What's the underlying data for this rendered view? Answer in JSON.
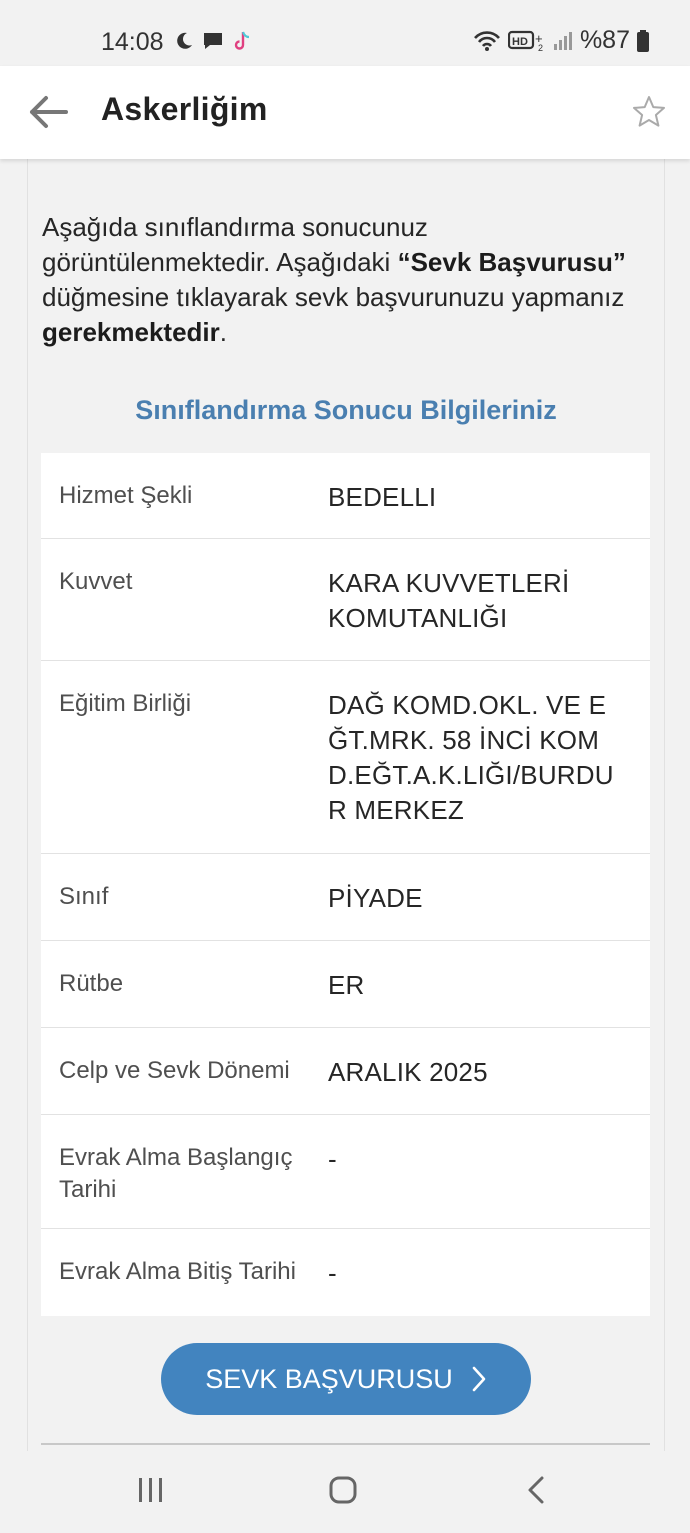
{
  "status_bar": {
    "time": "14:08",
    "battery": "%87",
    "icons_left": [
      "moon-icon",
      "message-icon",
      "tiktok-icon"
    ],
    "icons_right": [
      "wifi-icon",
      "hd-voice-icon",
      "signal-icon",
      "battery-icon"
    ]
  },
  "header": {
    "title": "Askerliğim"
  },
  "intro": {
    "part1": "Aşağıda sınıflandırma sonucunuz görüntülenmektedir. Aşağıdaki ",
    "bold1": "“Sevk Başvurusu”",
    "part2": " düğmesine tıklayarak sevk başvurunuzu yapmanız ",
    "bold2": "gerekmektedir",
    "part3": "."
  },
  "section_title": "Sınıflandırma Sonucu Bilgileriniz",
  "rows": [
    {
      "label": "Hizmet Şekli",
      "value": "BEDELLI"
    },
    {
      "label": "Kuvvet",
      "value": "KARA KUVVETLERİ KOMUTANLIĞI"
    },
    {
      "label": "Eğitim Birliği",
      "value": "DAĞ KOMD.OKL. VE EĞT.MRK. 58 İNCİ KOMD.EĞT.A.K.LIĞI/BURDUR MERKEZ"
    },
    {
      "label": "Sınıf",
      "value": "PİYADE"
    },
    {
      "label": "Rütbe",
      "value": "ER"
    },
    {
      "label": "Celp ve Sevk Dönemi",
      "value": "ARALIK 2025"
    },
    {
      "label": "Evrak Alma Başlangıç Tarihi",
      "value": "-"
    },
    {
      "label": "Evrak Alma Bitiş Tarihi",
      "value": "-"
    }
  ],
  "button": {
    "label": "SEVK BAŞVURUSU"
  },
  "colors": {
    "accent": "#4284bf",
    "section_title": "#4a7fb0",
    "background": "#f2f2f2"
  }
}
